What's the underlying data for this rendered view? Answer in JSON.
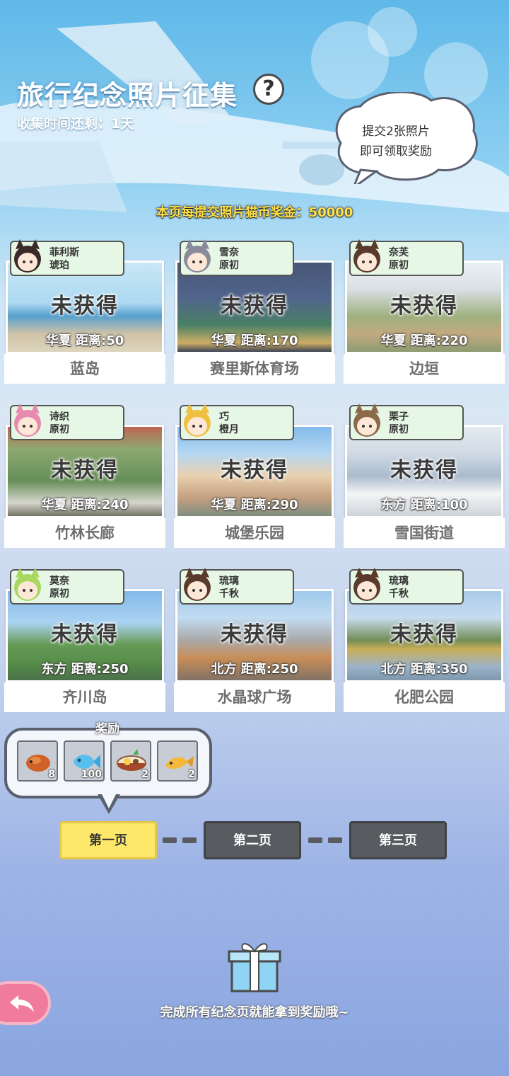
{
  "header": {
    "title": "旅行纪念照片征集",
    "help_label": "?",
    "time_remaining": "收集时间还剩：1天",
    "bubble_line1": "提交2张照片",
    "bubble_line2": "即可领取奖励",
    "bonus_text": "本页每提交照片猫币奖金：50000"
  },
  "cards": [
    {
      "char_line1": "菲利斯",
      "char_line2": "琥珀",
      "status": "未获得",
      "distance": "华夏  距离:50",
      "name": "蓝岛"
    },
    {
      "char_line1": "雪奈",
      "char_line2": "原初",
      "status": "未获得",
      "distance": "华夏  距离:170",
      "name": "赛里斯体育场"
    },
    {
      "char_line1": "奈芙",
      "char_line2": "原初",
      "status": "未获得",
      "distance": "华夏  距离:220",
      "name": "边垣"
    },
    {
      "char_line1": "诗织",
      "char_line2": "原初",
      "status": "未获得",
      "distance": "华夏  距离:240",
      "name": "竹林长廊"
    },
    {
      "char_line1": "巧",
      "char_line2": "橙月",
      "status": "未获得",
      "distance": "华夏  距离:290",
      "name": "城堡乐园"
    },
    {
      "char_line1": "栗子",
      "char_line2": "原初",
      "status": "未获得",
      "distance": "东方  距离:100",
      "name": "雪国街道"
    },
    {
      "char_line1": "莫奈",
      "char_line2": "原初",
      "status": "未获得",
      "distance": "东方  距离:250",
      "name": "齐川岛"
    },
    {
      "char_line1": "琉璃",
      "char_line2": "千秋",
      "status": "未获得",
      "distance": "北方  距离:250",
      "name": "水晶球广场"
    },
    {
      "char_line1": "琉璃",
      "char_line2": "千秋",
      "status": "未获得",
      "distance": "北方  距离:350",
      "name": "化肥公园"
    }
  ],
  "rewards": {
    "label": "奖励",
    "items": [
      {
        "icon": "roast-fish-icon",
        "qty": "8"
      },
      {
        "icon": "blue-fish-icon",
        "qty": "100"
      },
      {
        "icon": "ramen-bowl-icon",
        "qty": "2"
      },
      {
        "icon": "dried-fish-icon",
        "qty": "2"
      }
    ]
  },
  "pages": {
    "p1": "第一页",
    "p2": "第二页",
    "p3": "第三页",
    "active": "第一页"
  },
  "footer": {
    "text": "完成所有纪念页就能拿到奖励哦~"
  },
  "colors": {
    "active_page": "#fde86a",
    "inactive_page": "#585b60",
    "tag_bg": "#e6f7e6",
    "bonus_text": "#ffe14a",
    "back_button": "#f07b9a"
  }
}
